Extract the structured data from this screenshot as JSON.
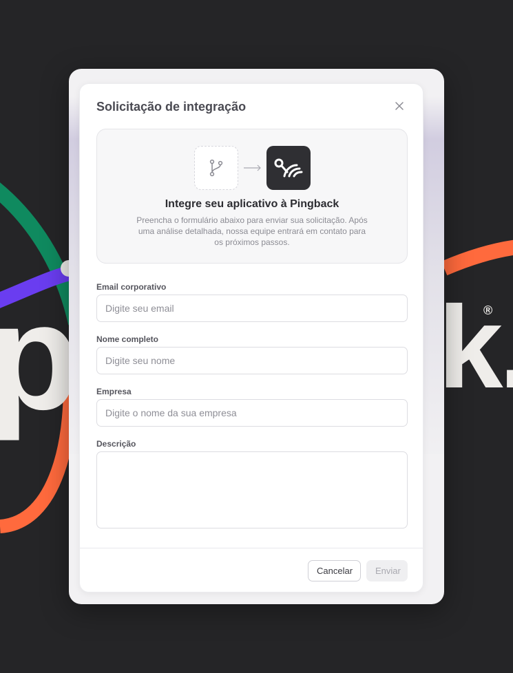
{
  "background": {
    "wordmark_left": "p",
    "wordmark_right": "k.",
    "registered": "®",
    "colors": {
      "page": "#252527",
      "green": "#0f8a5f",
      "purple": "#6a3df0",
      "orange": "#ff6a3d",
      "cream": "#efedea"
    }
  },
  "modal": {
    "title": "Solicitação de integração",
    "close_icon": "close-icon",
    "hero": {
      "source_icon": "git-branch-icon",
      "arrow_icon": "arrow-right-icon",
      "target_icon": "pingback-logo",
      "title": "Integre seu aplicativo à Pingback",
      "description": "Preencha o formulário abaixo para enviar sua solicitação. Após uma análise detalhada, nossa equipe entrará em contato para os próximos passos."
    },
    "fields": {
      "email": {
        "label": "Email corporativo",
        "placeholder": "Digite seu email",
        "value": ""
      },
      "name": {
        "label": "Nome completo",
        "placeholder": "Digite seu nome",
        "value": ""
      },
      "company": {
        "label": "Empresa",
        "placeholder": "Digite o nome da sua empresa",
        "value": ""
      },
      "description": {
        "label": "Descrição",
        "placeholder": "",
        "value": ""
      }
    },
    "footer": {
      "cancel_label": "Cancelar",
      "submit_label": "Enviar",
      "submit_disabled": true
    }
  }
}
